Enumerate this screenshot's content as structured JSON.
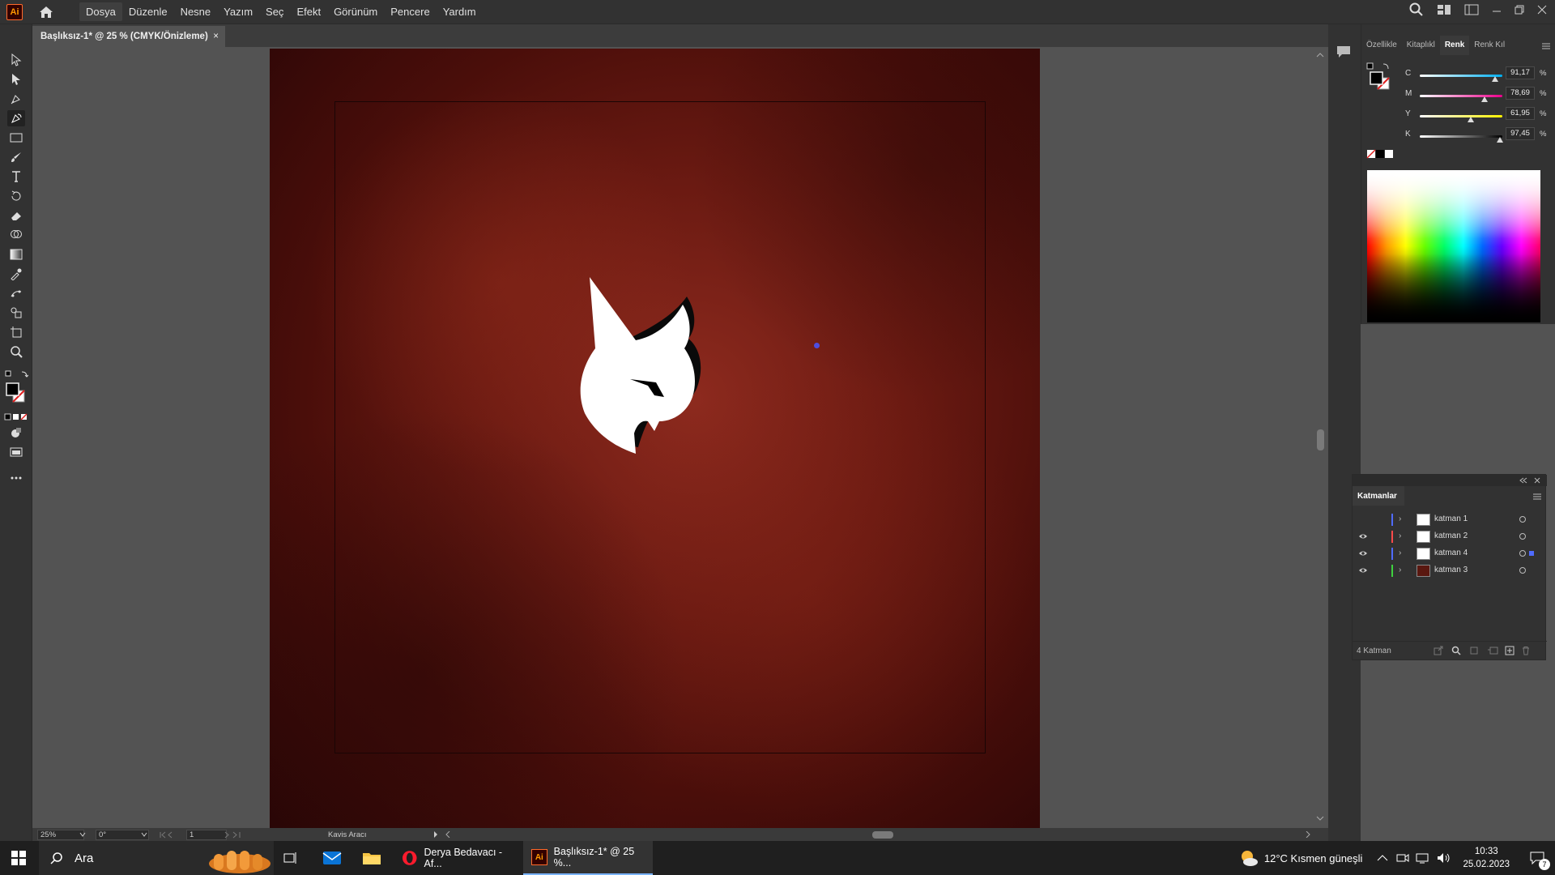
{
  "app": {
    "logo_text": "Ai"
  },
  "menu": [
    "Dosya",
    "Düzenle",
    "Nesne",
    "Yazım",
    "Seç",
    "Efekt",
    "Görünüm",
    "Pencere",
    "Yardım"
  ],
  "document_tab": {
    "title": "Başlıksız-1* @ 25 % (CMYK/Önizleme)",
    "close": "×"
  },
  "status_bar": {
    "zoom": "25%",
    "rotation": "0°",
    "artboard": "1",
    "tool_name": "Kavis Aracı"
  },
  "color_panel": {
    "tabs": [
      "Özellikle",
      "Kitaplıkl",
      "Renk",
      "Renk Kıl"
    ],
    "active_tab": "Renk",
    "sliders": [
      {
        "label": "C",
        "value": "91,17",
        "fraction": 0.9117
      },
      {
        "label": "M",
        "value": "78,69",
        "fraction": 0.7869
      },
      {
        "label": "Y",
        "value": "61,95",
        "fraction": 0.6195
      },
      {
        "label": "K",
        "value": "97,45",
        "fraction": 0.9745
      }
    ],
    "unit": "%"
  },
  "layers_panel": {
    "title": "Katmanlar",
    "layers": [
      {
        "name": "katman 1",
        "visible": false,
        "color": "#4f6bff"
      },
      {
        "name": "katman 2",
        "visible": true,
        "color": "#ff4a4a"
      },
      {
        "name": "katman 4",
        "visible": true,
        "color": "#4f6bff"
      },
      {
        "name": "katman 3",
        "visible": true,
        "color": "#3fd13f"
      }
    ],
    "count_label": "4 Katman"
  },
  "taskbar": {
    "search_placeholder": "Ara",
    "apps": [
      {
        "label": "Derya Bedavacı - Af..."
      },
      {
        "label": "Başlıksız-1* @ 25 %..."
      }
    ],
    "weather": "12°C  Kısmen güneşli",
    "time": "10:33",
    "date": "25.02.2023",
    "notification_count": "7"
  }
}
